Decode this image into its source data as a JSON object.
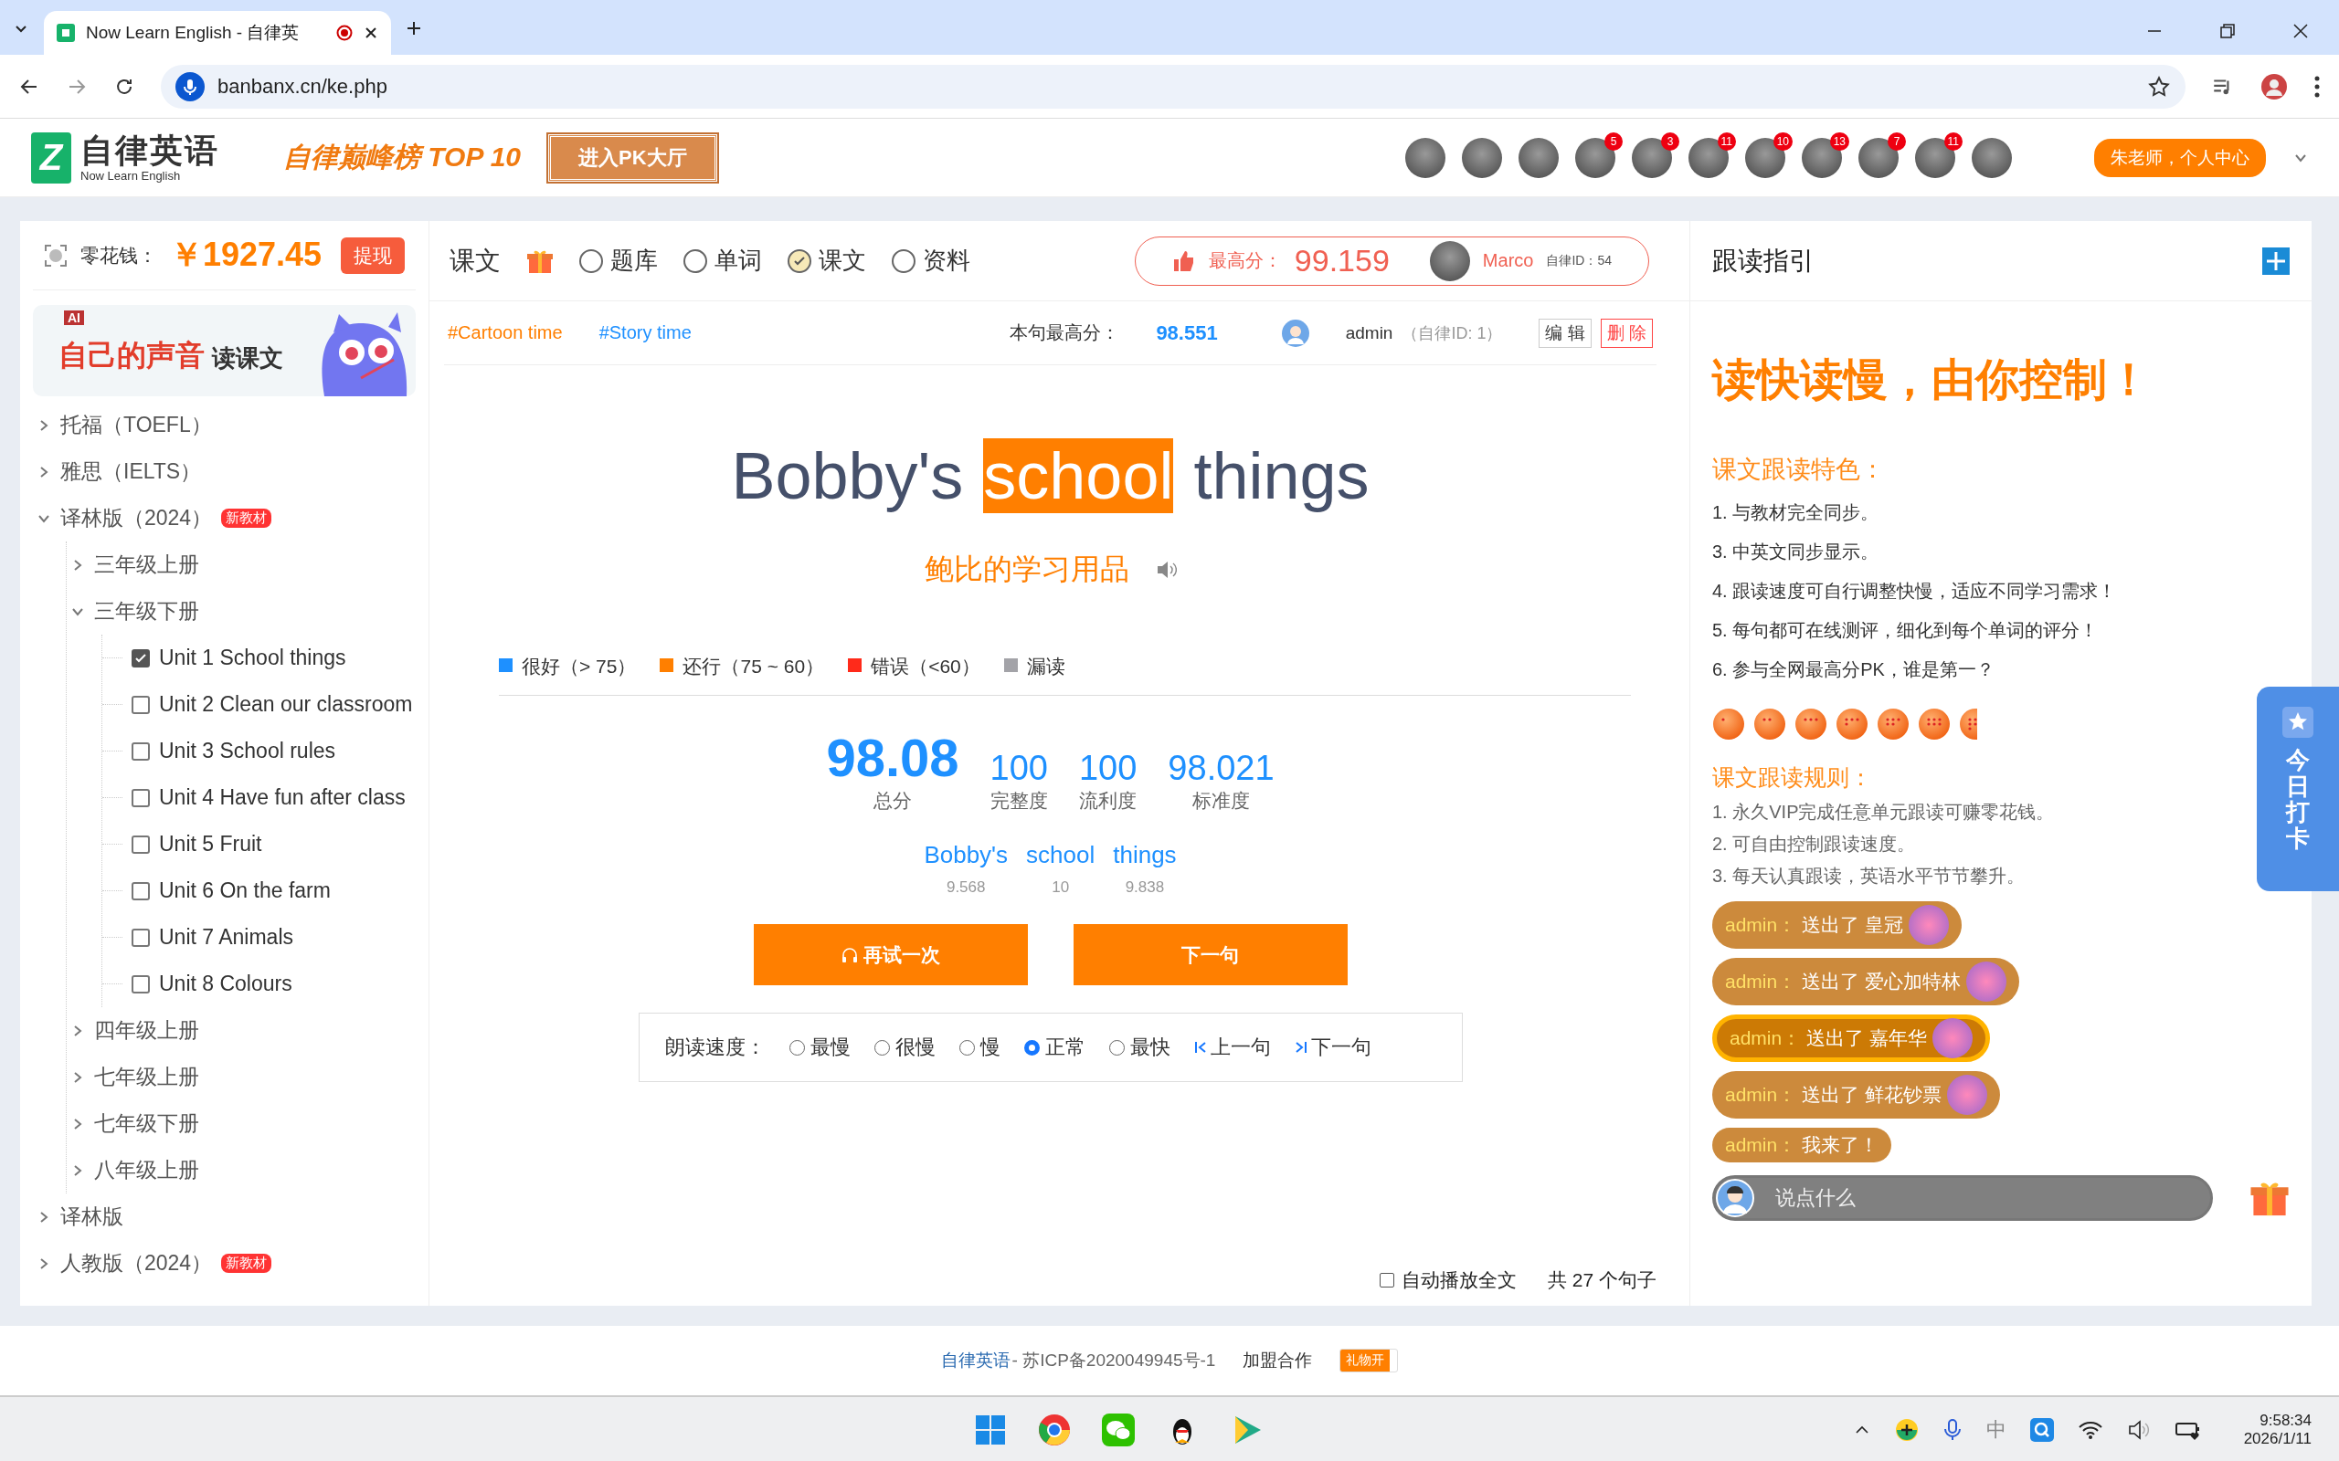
{
  "browser": {
    "tab_title": "Now Learn English - 自律英",
    "url": "banbanx.cn/ke.php"
  },
  "header": {
    "logo_mark": "Z",
    "logo_title": "自律英语",
    "logo_subtitle": "Now Learn English",
    "ranking_title": "自律巅峰榜 TOP 10",
    "pk_button": "进入PK大厅",
    "leaders": [
      {
        "has_badge": false
      },
      {
        "has_badge": false
      },
      {
        "has_badge": false
      },
      {
        "has_badge": true,
        "badge": "5"
      },
      {
        "has_badge": true,
        "badge": "3"
      },
      {
        "has_badge": true,
        "badge": "11"
      },
      {
        "has_badge": true,
        "badge": "10"
      },
      {
        "has_badge": true,
        "badge": "13"
      },
      {
        "has_badge": true,
        "badge": "7"
      },
      {
        "has_badge": true,
        "badge": "11"
      },
      {
        "has_badge": false
      }
    ],
    "user_button": "朱老师，个人中心"
  },
  "sidebar": {
    "wallet_label": "零花钱：",
    "amount": "￥1927.45",
    "withdraw": "提现",
    "banner": {
      "ai": "AI",
      "title": "自己的声音",
      "subtitle": "读课文"
    },
    "tree": [
      {
        "kind": "folder",
        "label": "托福（TOEFL）",
        "expanded": false
      },
      {
        "kind": "folder",
        "label": "雅思（IELTS）",
        "expanded": false
      },
      {
        "kind": "folder",
        "label": "译林版（2024）",
        "badge": "新教材",
        "expanded": true,
        "children": [
          {
            "kind": "folder",
            "label": "三年级上册",
            "expanded": false
          },
          {
            "kind": "folder",
            "label": "三年级下册",
            "expanded": true,
            "children": [
              {
                "kind": "unit",
                "label": "Unit 1 School things",
                "checked": true
              },
              {
                "kind": "unit",
                "label": "Unit 2 Clean our classroom",
                "checked": false
              },
              {
                "kind": "unit",
                "label": "Unit 3 School rules",
                "checked": false
              },
              {
                "kind": "unit",
                "label": "Unit 4 Have fun after class",
                "checked": false
              },
              {
                "kind": "unit",
                "label": "Unit 5 Fruit",
                "checked": false
              },
              {
                "kind": "unit",
                "label": "Unit 6 On the farm",
                "checked": false
              },
              {
                "kind": "unit",
                "label": "Unit 7 Animals",
                "checked": false
              },
              {
                "kind": "unit",
                "label": "Unit 8 Colours",
                "checked": false
              }
            ]
          },
          {
            "kind": "folder",
            "label": "四年级上册",
            "expanded": false
          },
          {
            "kind": "folder",
            "label": "七年级上册",
            "expanded": false
          },
          {
            "kind": "folder",
            "label": "七年级下册",
            "expanded": false
          },
          {
            "kind": "folder",
            "label": "八年级上册",
            "expanded": false
          }
        ]
      },
      {
        "kind": "folder",
        "label": "译林版",
        "expanded": false
      },
      {
        "kind": "folder",
        "label": "人教版（2024）",
        "badge": "新教材",
        "expanded": false
      }
    ]
  },
  "center": {
    "title": "课文",
    "types": [
      {
        "label": "题库",
        "selected": false
      },
      {
        "label": "单词",
        "selected": false
      },
      {
        "label": "课文",
        "selected": true
      },
      {
        "label": "资料",
        "selected": false
      }
    ],
    "best": {
      "label": "最高分：",
      "score": "99.159",
      "user": "Marco",
      "id": "自律ID：54"
    },
    "tags": [
      {
        "label": "#Cartoon time",
        "color": "#ff7f00"
      },
      {
        "label": "#Story time",
        "color": "#1e90ff"
      }
    ],
    "sentence_best": {
      "label": "本句最高分：",
      "score": "98.551",
      "user": "admin",
      "id": "（自律ID: 1）",
      "edit": "编 辑",
      "delete": "删 除"
    },
    "sentence": {
      "words": [
        {
          "text": "Bobby's",
          "highlighted": false
        },
        {
          "text": "school",
          "highlighted": true
        },
        {
          "text": "things",
          "highlighted": false
        }
      ],
      "translation": "鲍比的学习用品"
    },
    "legend": [
      {
        "label": "很好（> 75）",
        "color": "#1e90ff"
      },
      {
        "label": "还行（75 ~ 60）",
        "color": "#ff7f00"
      },
      {
        "label": "错误（<60）",
        "color": "#ff2a1a"
      },
      {
        "label": "漏读",
        "color": "#a3a3a8"
      }
    ],
    "scores": {
      "total": "98.08",
      "total_label": "总分",
      "metrics": [
        {
          "value": "100",
          "label": "完整度"
        },
        {
          "value": "100",
          "label": "流利度"
        },
        {
          "value": "98.021",
          "label": "标准度"
        }
      ]
    },
    "word_scores": [
      {
        "word": "Bobby's",
        "score": "9.568"
      },
      {
        "word": "school",
        "score": "10"
      },
      {
        "word": "things",
        "score": "9.838"
      }
    ],
    "buttons": {
      "retry": "再试一次",
      "next": "下一句"
    },
    "speed": {
      "label": "朗读速度：",
      "options": [
        {
          "label": "最慢",
          "selected": false
        },
        {
          "label": "很慢",
          "selected": false
        },
        {
          "label": "慢",
          "selected": false
        },
        {
          "label": "正常",
          "selected": true
        },
        {
          "label": "最快",
          "selected": false
        }
      ],
      "prev": "上一句",
      "next": "下一句"
    },
    "autoplay": {
      "label": "自动播放全文",
      "checked": false
    },
    "count": "共 27 个句子"
  },
  "guide": {
    "title": "跟读指引",
    "slogan": "读快读慢，由你控制！",
    "features_title": "课文跟读特色：",
    "features": [
      "1. 与教材完全同步。",
      "3. 中英文同步显示。",
      "4. 跟读速度可自行调整快慢，适应不同学习需求！",
      "5. 每句都可在线测评，细化到每个单词的评分！",
      "6. 参与全网最高分PK，谁是第一？"
    ],
    "rules_title": "课文跟读规则：",
    "rules": [
      "1. 永久VIP完成任意单元跟读可赚零花钱。",
      "2. 可自由控制跟读速度。",
      "3. 每天认真跟读，英语水平节节攀升。"
    ],
    "messages": [
      {
        "kind": "gift",
        "user": "admin：",
        "text": "送出了 皇冠",
        "highlighted": false
      },
      {
        "kind": "gift",
        "user": "admin：",
        "text": "送出了 爱心加特林",
        "highlighted": false
      },
      {
        "kind": "gift",
        "user": "admin：",
        "text": "送出了 嘉年华",
        "highlighted": true
      },
      {
        "kind": "gift",
        "user": "admin：",
        "text": "送出了 鲜花钞票",
        "highlighted": false
      },
      {
        "kind": "text",
        "user": "admin：",
        "text": "我来了！",
        "highlighted": false
      }
    ],
    "chat_placeholder": "说点什么",
    "checkin": "今日打卡"
  },
  "footer": {
    "site": "自律英语",
    "icp": "- 苏ICP备2020049945号-1",
    "join": "加盟合作",
    "gift_toggle": {
      "label": "礼物开",
      "on": true
    }
  },
  "taskbar": {
    "ime": "中",
    "time": "9:58:34",
    "date": "2026/1/11"
  }
}
